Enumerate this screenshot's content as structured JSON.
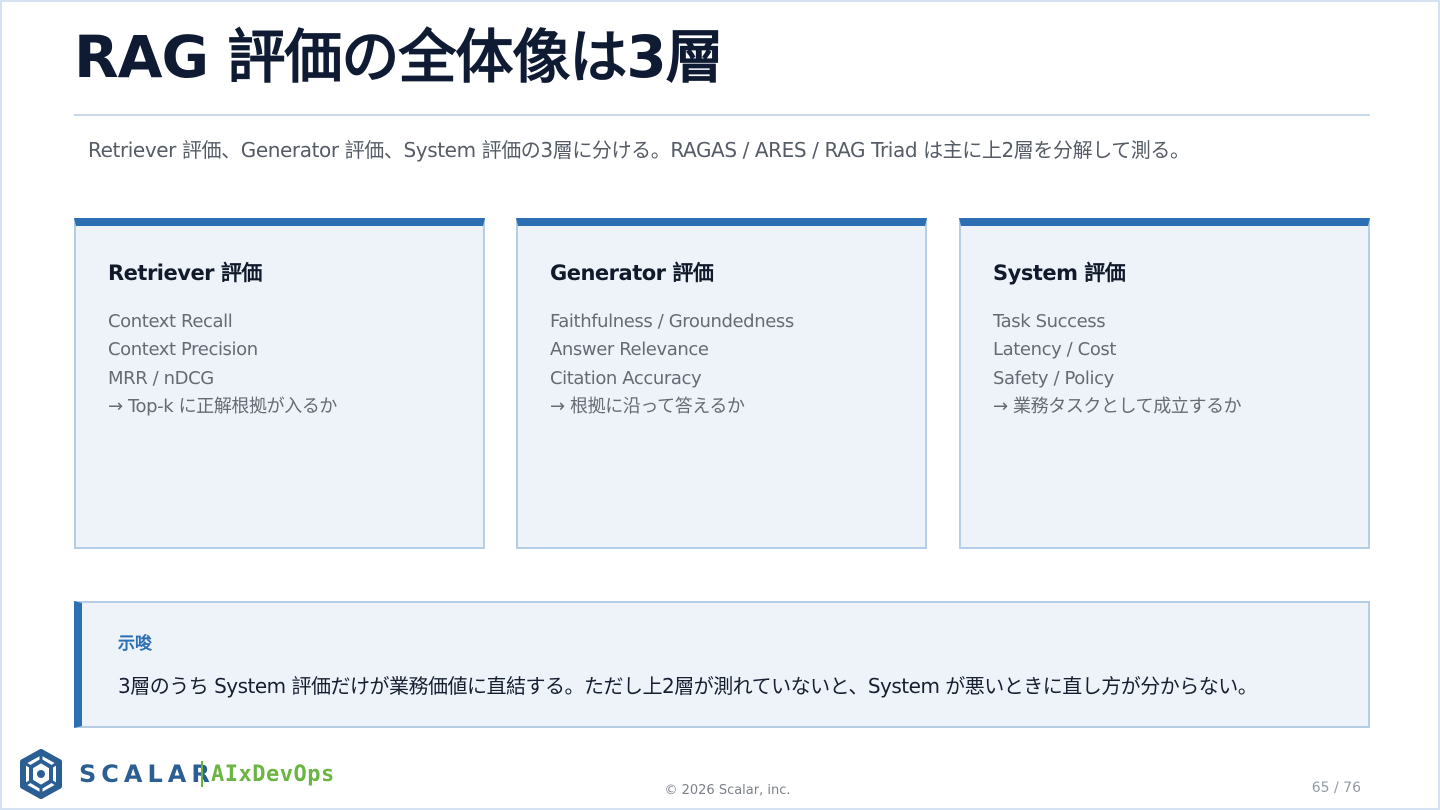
{
  "slide": {
    "title": "RAG 評価の全体像は3層",
    "subtitle": "Retriever 評価、Generator 評価、System 評価の3層に分ける。RAGAS / ARES / RAG Triad は主に上2層を分解して測る。",
    "page_number": "65 / 76",
    "copyright": "© 2026 Scalar, inc."
  },
  "cards": [
    {
      "title": "Retriever 評価",
      "items": [
        "Context Recall",
        "Context Precision",
        "MRR / nDCG",
        "→ Top-k に正解根拠が入るか"
      ]
    },
    {
      "title": "Generator 評価",
      "items": [
        "Faithfulness / Groundedness",
        "Answer Relevance",
        "Citation Accuracy",
        "→ 根拠に沿って答えるか"
      ]
    },
    {
      "title": "System 評価",
      "items": [
        "Task Success",
        "Latency / Cost",
        "Safety / Policy",
        "→ 業務タスクとして成立するか"
      ]
    }
  ],
  "note": {
    "label": "示唆",
    "text": "3層のうち System 評価だけが業務価値に直結する。ただし上2層が測れていないと、System が悪いときに直し方が分からない。"
  },
  "logo": {
    "brand": "SCALAR",
    "product": "AIxDevOps",
    "icon": "scalar-hexagon-logo-icon"
  },
  "colors": {
    "title": "#0f1b33",
    "accent_blue": "#2d6fb3",
    "card_background": "#eef3fa",
    "card_border": "#b6cde6",
    "logo_blue": "#2b5f93",
    "logo_green": "#6bb543"
  }
}
